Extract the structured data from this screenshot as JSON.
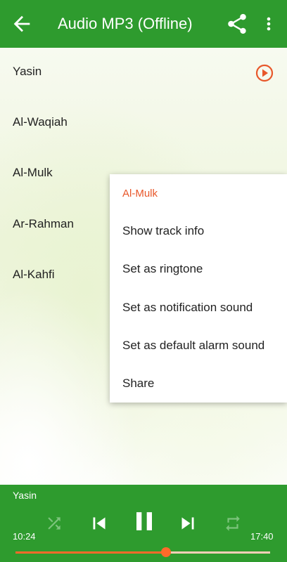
{
  "appbar": {
    "title": "Audio MP3 (Offline)",
    "back_icon": "arrow-back-icon",
    "share_icon": "share-icon",
    "more_icon": "more-vert-icon",
    "color": "#2e9b2e"
  },
  "tracks": [
    {
      "label": "Yasin",
      "playing": true
    },
    {
      "label": "Al-Waqiah"
    },
    {
      "label": "Al-Mulk"
    },
    {
      "label": "Ar-Rahman"
    },
    {
      "label": "Al-Kahfi"
    }
  ],
  "context_menu": {
    "title": "Al-Mulk",
    "items": [
      "Show track info",
      "Set as ringtone",
      "Set as notification sound",
      "Set as default alarm sound",
      "Share"
    ],
    "title_color": "#e8572a"
  },
  "player": {
    "track": "Yasin",
    "current_time": "10:24",
    "total_time": "17:40",
    "progress_fraction": 0.59,
    "accent_color": "#ff6a2a",
    "icons": [
      "shuffle-icon",
      "skip-previous-icon",
      "pause-icon",
      "skip-next-icon",
      "repeat-icon"
    ]
  }
}
